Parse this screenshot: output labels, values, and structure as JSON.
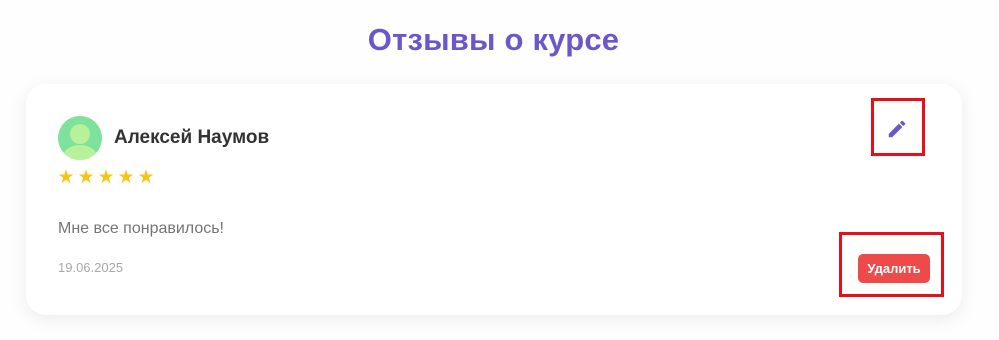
{
  "page": {
    "title": "Отзывы о курсе",
    "accent_color": "#6b57c9"
  },
  "review": {
    "author": "Алексей Наумов",
    "rating": 5,
    "stars": [
      "★",
      "★",
      "★",
      "★",
      "★"
    ],
    "text": "Мне все понравилось!",
    "date": "19.06.2025",
    "avatar_icon": "user-avatar-icon",
    "edit_icon": "pencil-icon",
    "delete_label": "Удалить",
    "delete_color": "#ef4a4a",
    "star_color": "#f5c518"
  }
}
